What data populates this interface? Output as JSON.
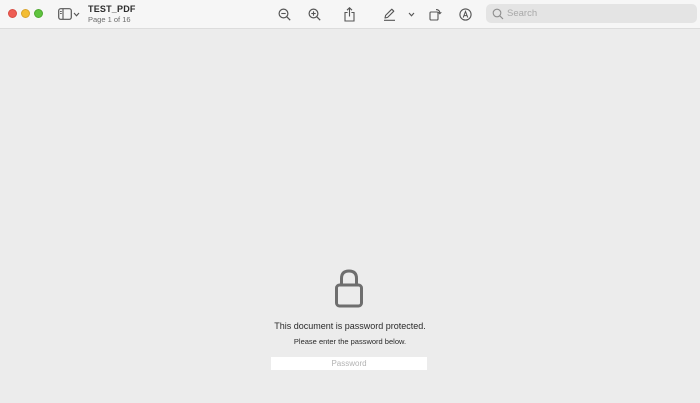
{
  "window": {
    "title": "TEST_PDF",
    "subtitle": "Page 1 of 16"
  },
  "toolbar": {
    "icons": [
      "sidebar-icon",
      "chevron-down-icon",
      "zoom-out-icon",
      "zoom-in-icon",
      "share-icon",
      "markup-pen-icon",
      "chevron-down-icon",
      "rotate-icon",
      "annotate-icon"
    ]
  },
  "search": {
    "placeholder": "Search",
    "value": ""
  },
  "main": {
    "message": "This document is password protected.",
    "instruction": "Please enter the password below.",
    "password_placeholder": "Password",
    "password_value": ""
  },
  "colors": {
    "close": "#ee5d54",
    "minimize": "#f3bd33",
    "zoom": "#5fc33e",
    "background": "#ececec",
    "lock": "#6e6e6e"
  }
}
